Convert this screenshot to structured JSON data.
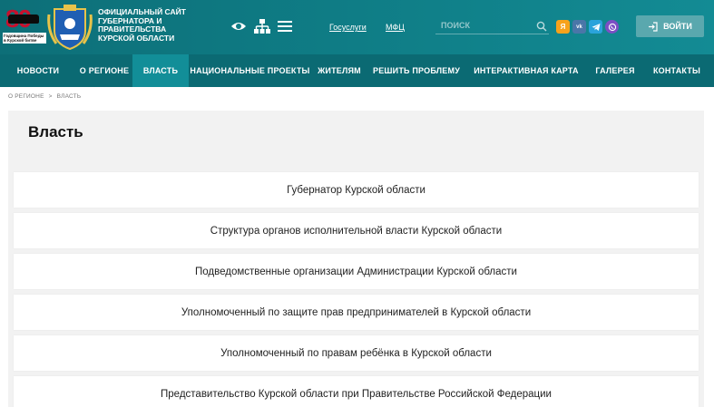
{
  "header": {
    "logo80": {
      "digits": "80",
      "caption": "Годовщина Победы в Курской битве"
    },
    "site_title": "Официальный сайт губернатора и правительства Курской области",
    "links": {
      "gosuslugi": "Госуслуги",
      "mfc": "МФЦ"
    },
    "search": {
      "placeholder": "ПОИСК"
    },
    "social": {
      "yandex": "Я",
      "vk": "vk"
    },
    "login_label": "ВОЙТИ"
  },
  "nav": {
    "items": [
      {
        "label": "НОВОСТИ",
        "active": false
      },
      {
        "label": "О РЕГИОНЕ",
        "active": false
      },
      {
        "label": "ВЛАСТЬ",
        "active": true
      },
      {
        "label": "НАЦИОНАЛЬНЫЕ ПРОЕКТЫ",
        "active": false
      },
      {
        "label": "ЖИТЕЛЯМ",
        "active": false
      },
      {
        "label": "РЕШИТЬ ПРОБЛЕМУ",
        "active": false
      },
      {
        "label": "ИНТЕРАКТИВНАЯ КАРТА",
        "active": false
      },
      {
        "label": "ГАЛЕРЕЯ",
        "active": false
      },
      {
        "label": "КОНТАКТЫ",
        "active": false
      }
    ]
  },
  "breadcrumb": {
    "items": [
      "О РЕГИОНЕ",
      "ВЛАСТЬ"
    ],
    "separator": ">"
  },
  "main": {
    "title": "Власть",
    "list": [
      "Губернатор Курской области",
      "Структура органов исполнительной власти Курской области",
      "Подведомственные организации Администрации Курской области",
      "Уполномоченный по защите прав предпринимателей в Курской области",
      "Уполномоченный по правам ребёнка в Курской области",
      "Представительство Курской области при Правительстве Российской Федерации"
    ]
  },
  "colors": {
    "header_bg": "#0f7d86",
    "nav_bg": "#0b6a73",
    "nav_active": "#128e98",
    "login_bg": "#5aa8ae"
  },
  "icons": {
    "eye": "eye-icon",
    "sitemap": "sitemap-icon",
    "menu": "hamburger-menu-icon",
    "search": "search-icon",
    "yandex": "yandex-icon",
    "vk": "vk-icon",
    "telegram": "telegram-icon",
    "viber": "viber-icon",
    "login": "login-icon"
  }
}
